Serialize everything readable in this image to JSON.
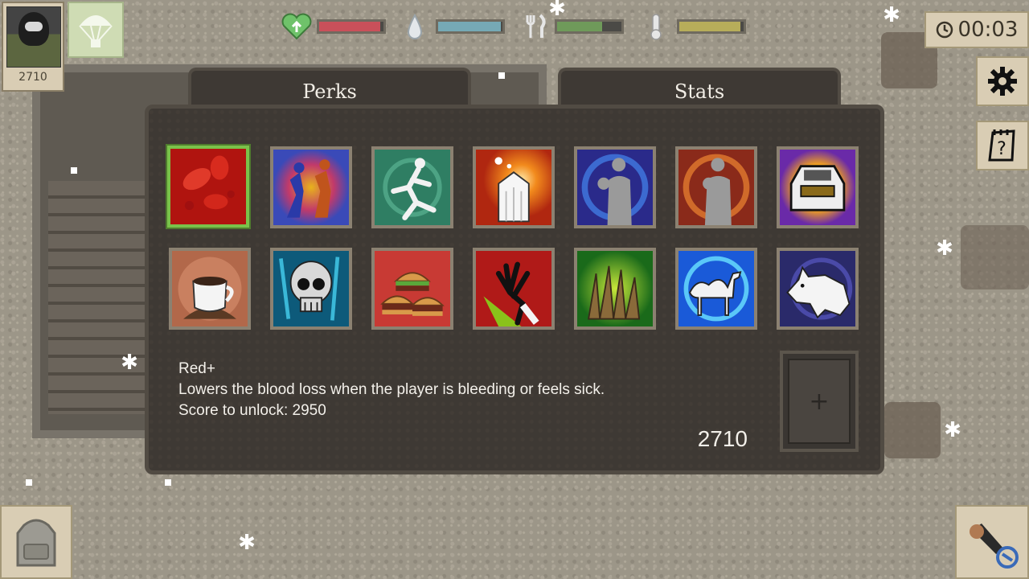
{
  "player": {
    "score_display": "2710"
  },
  "hud": {
    "health": {
      "level": 0.95,
      "color": "#c9505a"
    },
    "thirst": {
      "level": 0.98,
      "color": "#76a9b5"
    },
    "hunger": {
      "level": 0.7,
      "color": "#6f9a5a"
    },
    "temperature": {
      "level": 0.95,
      "color": "#b7ad5a"
    },
    "timer": "00:03"
  },
  "tabs": {
    "perks": "Perks",
    "stats": "Stats"
  },
  "perks": [
    {
      "icon": "blood-cells-icon",
      "selected": true
    },
    {
      "icon": "running-survivors-icon",
      "selected": false
    },
    {
      "icon": "sprinting-man-icon",
      "selected": false
    },
    {
      "icon": "melting-ice-icon",
      "selected": false
    },
    {
      "icon": "boxer-blue-icon",
      "selected": false
    },
    {
      "icon": "boxer-red-icon",
      "selected": false
    },
    {
      "icon": "armored-car-icon",
      "selected": false
    },
    {
      "icon": "tea-cup-icon",
      "selected": false
    },
    {
      "icon": "skull-icon",
      "selected": false
    },
    {
      "icon": "burgers-icon",
      "selected": false
    },
    {
      "icon": "gloved-hand-icon",
      "selected": false
    },
    {
      "icon": "wooden-spikes-icon",
      "selected": false
    },
    {
      "icon": "camel-icon",
      "selected": false
    },
    {
      "icon": "white-wolf-icon",
      "selected": false
    }
  ],
  "selected_perk": {
    "name": "Red+",
    "description": "Lowers the blood loss when the player is bleeding or feels sick.",
    "unlock_text": "Score to unlock:  2950"
  },
  "current_score": "2710",
  "slot_label": "+"
}
